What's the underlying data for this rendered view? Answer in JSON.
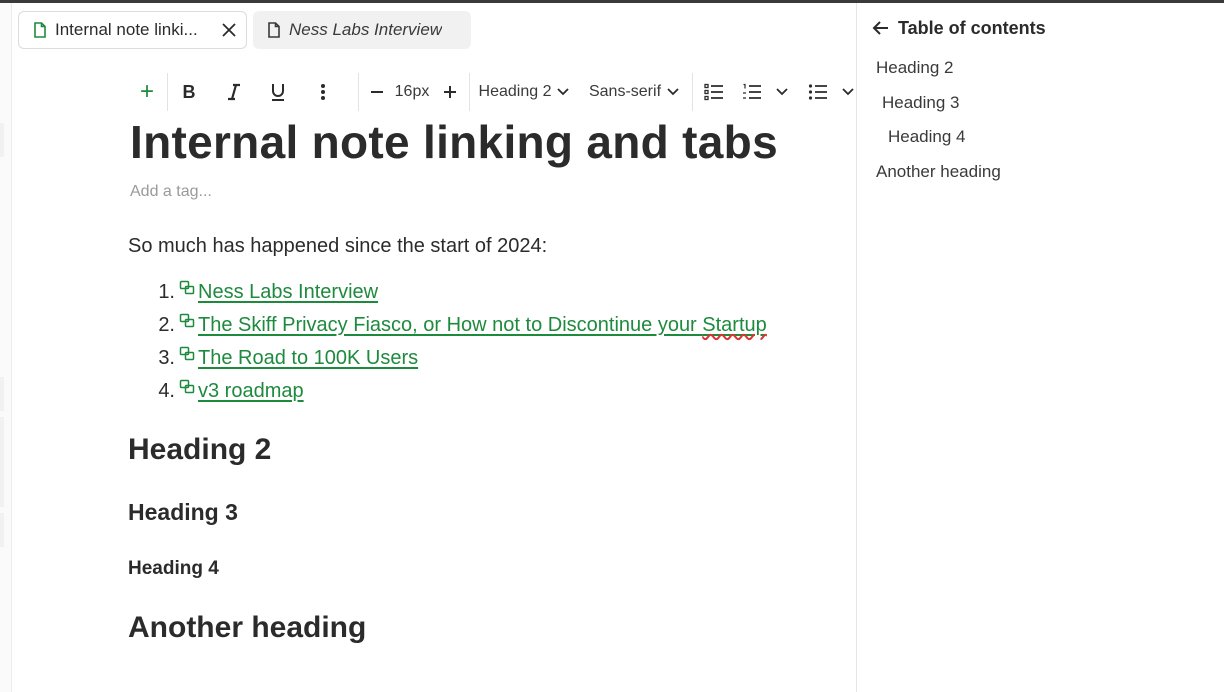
{
  "tabs": [
    {
      "label": "Internal note linki...",
      "active": true
    },
    {
      "label": "Ness Labs Interview",
      "active": false
    }
  ],
  "toolbar": {
    "add": "+",
    "bold": "B",
    "italic": "I",
    "underline": "U",
    "more": "⋮",
    "minus": "−",
    "font_size": "16px",
    "plus": "+",
    "block_type": "Heading 2",
    "font_family": "Sans-serif"
  },
  "document": {
    "title": "Internal note linking and tabs",
    "tag_placeholder": "Add a tag...",
    "intro": "So much has happened since the start of 2024:",
    "list": [
      {
        "num": "1.",
        "text": "Ness Labs Interview"
      },
      {
        "num": "2.",
        "text_before": "The Skiff Privacy Fiasco, or How not to Discontinue your ",
        "text_misspelled": "Startup"
      },
      {
        "num": "3.",
        "text": "The Road to 100K Users"
      },
      {
        "num": "4.",
        "text": "v3 roadmap"
      }
    ],
    "heading2": "Heading 2",
    "heading3": "Heading 3",
    "heading4": "Heading 4",
    "another_heading": "Another heading"
  },
  "toc": {
    "title": "Table of contents",
    "items": [
      "Heading 2",
      "Heading 3",
      "Heading 4",
      "Another heading"
    ]
  },
  "colors": {
    "accent_green": "#1e8a3e",
    "text": "#2b2b2b",
    "placeholder": "#9a9a9a"
  },
  "icons": {
    "tab_doc": "document-icon",
    "close": "close-icon",
    "link": "internal-link-icon",
    "toc_back": "arrow-left-icon"
  }
}
